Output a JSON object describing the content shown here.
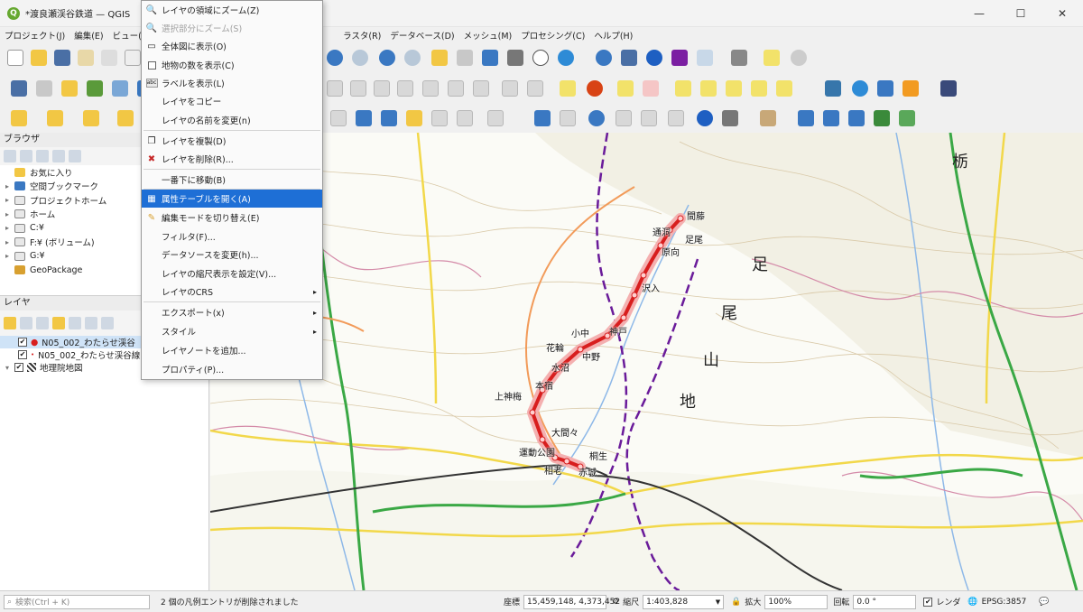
{
  "window": {
    "title": "*渡良瀬渓谷鉄道 — QGIS",
    "controls": [
      "—",
      "☐",
      "✕"
    ]
  },
  "menubar": {
    "items": [
      "プロジェクト(J)",
      "編集(E)",
      "ビュー(V)",
      "ラスタ(R)",
      "データベース(D)",
      "メッシュ(M)",
      "プロセシング(C)",
      "ヘルプ(H)"
    ]
  },
  "browser": {
    "title": "ブラウザ",
    "items": [
      {
        "label": "お気に入り",
        "icon": "star-icon"
      },
      {
        "label": "空間ブックマーク",
        "icon": "bookmark-icon"
      },
      {
        "label": "プロジェクトホーム",
        "icon": "folder-icon"
      },
      {
        "label": "ホーム",
        "icon": "folder-icon"
      },
      {
        "label": "C:¥",
        "icon": "folder-icon"
      },
      {
        "label": "F:¥ (ボリューム)",
        "icon": "folder-icon"
      },
      {
        "label": "G:¥",
        "icon": "folder-icon"
      },
      {
        "label": "GeoPackage",
        "icon": "geopackage-icon"
      }
    ]
  },
  "layers": {
    "title": "レイヤ",
    "items": [
      {
        "label": "N05_002_わたらせ渓谷",
        "checked": "✔",
        "selected": true
      },
      {
        "label": "N05_002_わたらせ渓谷線",
        "checked": "✔",
        "selected": false
      },
      {
        "label": "地理院地図",
        "checked": "✔",
        "selected": false
      }
    ]
  },
  "context_menu": {
    "items": [
      {
        "label": "レイヤの領域にズーム(Z)",
        "icon": "zoom-layer-icon",
        "disabled": false
      },
      {
        "label": "選択部分にズーム(S)",
        "icon": "zoom-selection-icon",
        "disabled": true
      },
      {
        "label": "全体図に表示(O)",
        "icon": "overview-icon",
        "disabled": false
      },
      {
        "label": "地物の数を表示(C)",
        "icon": "checkbox-icon",
        "disabled": false
      },
      {
        "label": "ラベルを表示(L)",
        "icon": "label-icon",
        "disabled": false
      },
      {
        "label": "レイヤをコピー",
        "icon": "",
        "disabled": false
      },
      {
        "label": "レイヤの名前を変更(n)",
        "icon": "",
        "disabled": false
      },
      {
        "label": "レイヤを複製(D)",
        "icon": "duplicate-icon",
        "disabled": false
      },
      {
        "label": "レイヤを削除(R)...",
        "icon": "remove-icon",
        "disabled": false
      },
      {
        "label": "一番下に移動(B)",
        "icon": "",
        "disabled": false
      },
      {
        "label": "属性テーブルを開く(A)",
        "icon": "table-icon",
        "disabled": false,
        "highlight": true
      },
      {
        "label": "編集モードを切り替え(E)",
        "icon": "pencil-icon",
        "disabled": false
      },
      {
        "label": "フィルタ(F)...",
        "icon": "",
        "disabled": false
      },
      {
        "label": "データソースを変更(h)...",
        "icon": "",
        "disabled": false
      },
      {
        "label": "レイヤの縮尺表示を設定(V)...",
        "icon": "",
        "disabled": false
      },
      {
        "label": "レイヤのCRS",
        "icon": "",
        "disabled": false,
        "submenu": "▸"
      },
      {
        "label": "エクスポート(x)",
        "icon": "",
        "disabled": false,
        "submenu": "▸"
      },
      {
        "label": "スタイル",
        "icon": "",
        "disabled": false,
        "submenu": "▸"
      },
      {
        "label": "レイヤノートを追加...",
        "icon": "",
        "disabled": false
      },
      {
        "label": "プロパティ(P)...",
        "icon": "",
        "disabled": false
      }
    ]
  },
  "map": {
    "stations": [
      "間藤",
      "通洞",
      "足尾",
      "原向",
      "沢入",
      "神戸",
      "小中",
      "中野",
      "花輪",
      "水沼",
      "本宿",
      "上神梅",
      "大間々",
      "運動公園",
      "桐生",
      "相老",
      "赤城"
    ],
    "region_labels": [
      "栃",
      "足",
      "尾",
      "山",
      "地"
    ],
    "route_color": "#d81e1e"
  },
  "statusbar": {
    "search_placeholder": "検索(Ctrl + K)",
    "message": "2 個の凡例エントリが削除されました",
    "coord_label": "座標",
    "coord_value": "15,459,148, 4,373,452",
    "scale_label": "縮尺",
    "scale_value": "1:403,828",
    "magnify_label": "拡大",
    "magnify_value": "100%",
    "rotation_label": "回転",
    "rotation_value": "0.0 °",
    "render_label": "レンダ",
    "crs": "EPSG:3857"
  }
}
